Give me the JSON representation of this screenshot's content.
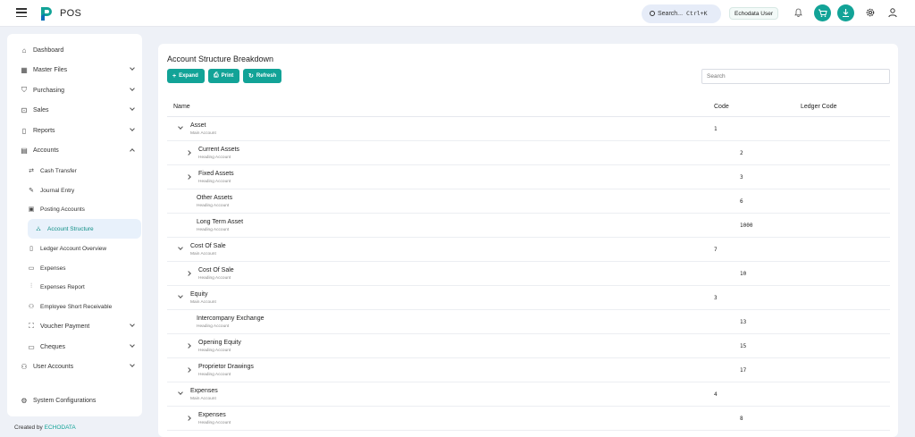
{
  "app": {
    "title": "POS"
  },
  "topbar": {
    "search_label": "Search...",
    "search_shortcut": "Ctrl+K",
    "user_label": "Echodata User",
    "accent_color": "#12a397"
  },
  "sidebar": {
    "items": [
      {
        "label": "Dashboard",
        "icon": "home-icon"
      },
      {
        "label": "Master Files",
        "icon": "grid-icon"
      },
      {
        "label": "Purchasing",
        "icon": "cart-icon"
      },
      {
        "label": "Sales",
        "icon": "bag-icon"
      },
      {
        "label": "Reports",
        "icon": "document-icon"
      },
      {
        "label": "Accounts",
        "icon": "ledger-icon"
      },
      {
        "label": "Cash Transfer",
        "icon": "transfer-icon"
      },
      {
        "label": "Journal Entry",
        "icon": "pencil-icon"
      },
      {
        "label": "Posting Accounts",
        "icon": "clipboard-icon"
      },
      {
        "label": "Account Structure",
        "icon": "hierarchy-icon"
      },
      {
        "label": "Ledger Account Overview",
        "icon": "book-icon"
      },
      {
        "label": "Expenses",
        "icon": "receipt-icon"
      },
      {
        "label": "Expenses Report",
        "icon": "bar-chart-icon"
      },
      {
        "label": "Employee Short Receivable",
        "icon": "users-icon"
      },
      {
        "label": "Voucher Payment",
        "icon": "voucher-icon"
      },
      {
        "label": "Cheques",
        "icon": "card-icon"
      },
      {
        "label": "User Accounts",
        "icon": "user-group-icon"
      },
      {
        "label": "System Configurations",
        "icon": "settings-icon"
      }
    ]
  },
  "main": {
    "title": "Account Structure Breakdown",
    "buttons": {
      "expand": "Expand",
      "print": "Print",
      "refresh": "Refresh"
    },
    "search_placeholder": "Search",
    "columns": {
      "name": "Name",
      "code": "Code",
      "ledger_code": "Ledger Code"
    },
    "rows": [
      {
        "name": "Asset",
        "type": "Main Account",
        "code": "1",
        "level": 0,
        "caret": "down"
      },
      {
        "name": "Current Assets",
        "type": "Heading Account",
        "code": "2",
        "level": 1,
        "caret": "right"
      },
      {
        "name": "Fixed Assets",
        "type": "Heading Account",
        "code": "3",
        "level": 1,
        "caret": "right"
      },
      {
        "name": "Other Assets",
        "type": "Heading Account",
        "code": "6",
        "level": 1,
        "caret": "none"
      },
      {
        "name": "Long Term Asset",
        "type": "Heading Account",
        "code": "1000",
        "level": 1,
        "caret": "none"
      },
      {
        "name": "Cost Of Sale",
        "type": "Main Account",
        "code": "7",
        "level": 0,
        "caret": "down"
      },
      {
        "name": "Cost Of Sale",
        "type": "Heading Account",
        "code": "10",
        "level": 1,
        "caret": "right"
      },
      {
        "name": "Equity",
        "type": "Main Account",
        "code": "3",
        "level": 0,
        "caret": "down"
      },
      {
        "name": "Intercompany Exchange",
        "type": "Heading Account",
        "code": "13",
        "level": 1,
        "caret": "none"
      },
      {
        "name": "Opening Equity",
        "type": "Heading Account",
        "code": "15",
        "level": 1,
        "caret": "right"
      },
      {
        "name": "Proprietor Drawings",
        "type": "Heading Account",
        "code": "17",
        "level": 1,
        "caret": "right"
      },
      {
        "name": "Expenses",
        "type": "Main Account",
        "code": "4",
        "level": 0,
        "caret": "down"
      },
      {
        "name": "Expenses",
        "type": "Heading Account",
        "code": "8",
        "level": 1,
        "caret": "right"
      }
    ]
  },
  "footer": {
    "prefix": "Created by",
    "brand": "ECHODATA"
  }
}
